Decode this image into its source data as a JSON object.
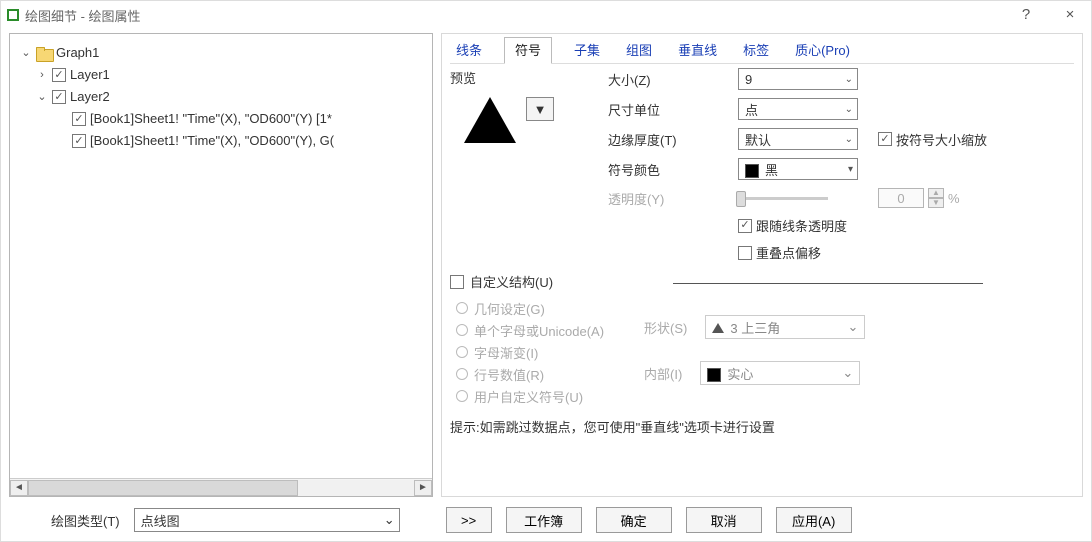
{
  "window": {
    "title": "绘图细节 - 绘图属性",
    "help": "?",
    "close": "×"
  },
  "tree": {
    "graph": "Graph1",
    "layer1": "Layer1",
    "layer2": "Layer2",
    "item1": "[Book1]Sheet1! \"Time\"(X), \"OD600\"(Y) [1*",
    "item2": "[Book1]Sheet1! \"Time\"(X), \"OD600\"(Y), G("
  },
  "tabs": {
    "line": "线条",
    "symbol": "符号",
    "subset": "子集",
    "group": "组图",
    "dropline": "垂直线",
    "label": "标签",
    "centroid": "质心(Pro)"
  },
  "symbol": {
    "preview_label": "预览",
    "size_label": "大小(Z)",
    "size_value": "9",
    "unit_label": "尺寸单位",
    "unit_value": "点",
    "edge_label": "边缘厚度(T)",
    "edge_value": "默认",
    "scale_label": "按符号大小缩放",
    "color_label": "符号颜色",
    "color_value": "黑",
    "opacity_label": "透明度(Y)",
    "opacity_value": "0",
    "opacity_pct": "%",
    "follow_line_label": "跟随线条透明度",
    "overlap_label": "重叠点偏移"
  },
  "custom": {
    "checkbox_label": "自定义结构(U)",
    "geom": "几何设定(G)",
    "single": "单个字母或Unicode(A)",
    "grad": "字母渐变(I)",
    "row": "行号数值(R)",
    "user": "用户自定义符号(U)",
    "shape_label": "形状(S)",
    "shape_value": "3 上三角",
    "fill_label": "内部(I)",
    "fill_value": "实心"
  },
  "hint": "提示:如需跳过数据点，您可使用\"垂直线\"选项卡进行设置",
  "bottom": {
    "plot_type_label": "绘图类型(T)",
    "plot_type_value": "点线图",
    "expand": ">>",
    "workbook": "工作簿",
    "ok": "确定",
    "cancel": "取消",
    "apply": "应用(A)"
  }
}
